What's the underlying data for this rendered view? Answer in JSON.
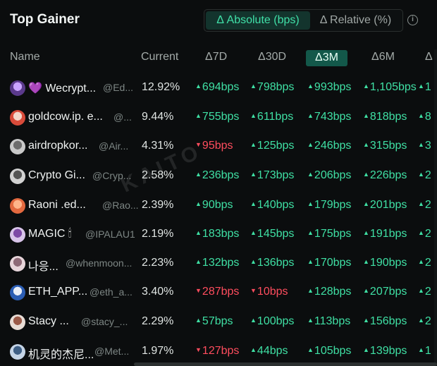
{
  "title": "Top Gainer",
  "toggle": {
    "absolute": "Δ Absolute (bps)",
    "relative": "Δ Relative (%)",
    "selected": "absolute"
  },
  "info_icon": "i",
  "headers": {
    "name": "Name",
    "current": "Current",
    "d7": "Δ7D",
    "d30": "Δ30D",
    "d3m": "Δ3M",
    "d6m": "Δ6M",
    "d12m": "Δ"
  },
  "watermark": "KAITO",
  "rows": [
    {
      "avatar": "purple-avatar",
      "name": "💜 Wecrypt...",
      "handle": "@Ed...",
      "current": "12.92%",
      "d7": "694bps",
      "d30": "798bps",
      "d3m": "993bps",
      "d6m": "1,105bps",
      "d12m": "1",
      "d7dir": "up",
      "d30dir": "up"
    },
    {
      "avatar": "cow-avatar",
      "name": "goldcow.ip. e...",
      "handle": "@...",
      "current": "9.44%",
      "d7": "755bps",
      "d30": "611bps",
      "d3m": "743bps",
      "d6m": "818bps",
      "d12m": "8",
      "d7dir": "up",
      "d30dir": "up"
    },
    {
      "avatar": "cat-avatar",
      "name": "airdropkor...",
      "handle": "@Air...",
      "current": "4.31%",
      "d7": "95bps",
      "d30": "125bps",
      "d3m": "246bps",
      "d6m": "315bps",
      "d12m": "3",
      "d7dir": "down",
      "d30dir": "up"
    },
    {
      "avatar": "gray-avatar",
      "name": "Crypto Gi...",
      "handle": "@Cryp...",
      "current": "2.58%",
      "d7": "236bps",
      "d30": "173bps",
      "d3m": "206bps",
      "d6m": "226bps",
      "d12m": "2",
      "d7dir": "up",
      "d30dir": "up"
    },
    {
      "avatar": "orange-avatar",
      "name": "Raoni .ed...",
      "handle": "@Rao...",
      "current": "2.39%",
      "d7": "90bps",
      "d30": "140bps",
      "d3m": "179bps",
      "d6m": "201bps",
      "d12m": "2",
      "d7dir": "up",
      "d30dir": "up"
    },
    {
      "avatar": "anime-avatar",
      "name": "MAGIC 🕯",
      "handle": "@IPALAU1",
      "current": "2.19%",
      "d7": "183bps",
      "d30": "145bps",
      "d3m": "175bps",
      "d6m": "191bps",
      "d12m": "2",
      "d7dir": "up",
      "d30dir": "up"
    },
    {
      "avatar": "pink-avatar",
      "name": "나응...",
      "handle": "@whenmoon...",
      "current": "2.23%",
      "d7": "132bps",
      "d30": "136bps",
      "d3m": "170bps",
      "d6m": "190bps",
      "d12m": "2",
      "d7dir": "up",
      "d30dir": "up"
    },
    {
      "avatar": "blue-avatar",
      "name": "ETH_APP...",
      "handle": "@eth_a...",
      "current": "3.40%",
      "d7": "287bps",
      "d30": "10bps",
      "d3m": "128bps",
      "d6m": "207bps",
      "d12m": "2",
      "d7dir": "down",
      "d30dir": "down"
    },
    {
      "avatar": "girl-avatar",
      "name": "Stacy ...",
      "handle": "@stacy_...",
      "current": "2.29%",
      "d7": "57bps",
      "d30": "100bps",
      "d3m": "113bps",
      "d6m": "156bps",
      "d12m": "2",
      "d7dir": "up",
      "d30dir": "up"
    },
    {
      "avatar": "dog-avatar",
      "name": "机灵的杰尼...",
      "handle": "@Met...",
      "current": "1.97%",
      "d7": "127bps",
      "d30": "44bps",
      "d3m": "105bps",
      "d6m": "139bps",
      "d12m": "1",
      "d7dir": "down",
      "d30dir": "up"
    }
  ]
}
